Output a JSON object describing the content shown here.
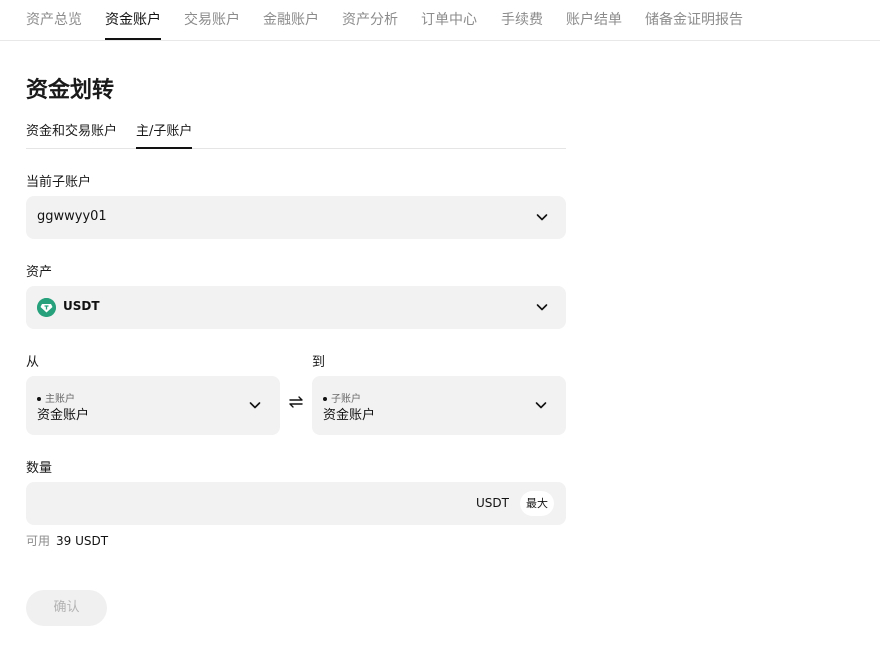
{
  "nav": {
    "items": [
      {
        "label": "资产总览"
      },
      {
        "label": "资金账户"
      },
      {
        "label": "交易账户"
      },
      {
        "label": "金融账户"
      },
      {
        "label": "资产分析"
      },
      {
        "label": "订单中心"
      },
      {
        "label": "手续费"
      },
      {
        "label": "账户结单"
      },
      {
        "label": "储备金证明报告"
      }
    ],
    "active": "资金账户"
  },
  "page": {
    "title": "资金划转"
  },
  "subtabs": [
    {
      "label": "资金和交易账户"
    },
    {
      "label": "主/子账户"
    }
  ],
  "subtab_active": "主/子账户",
  "form": {
    "subaccount": {
      "label": "当前子账户",
      "value": "ggwwyy01"
    },
    "asset": {
      "label": "资产",
      "value": "USDT",
      "icon": "tether-icon",
      "icon_color": "#26a17b"
    },
    "from": {
      "label": "从",
      "account_type": "主账户",
      "account": "资金账户"
    },
    "to": {
      "label": "到",
      "account_type": "子账户",
      "account": "资金账户"
    },
    "amount": {
      "label": "数量",
      "placeholder": "",
      "unit": "USDT",
      "max_label": "最大"
    },
    "available": {
      "label": "可用",
      "value": "39 USDT"
    },
    "confirm_label": "确认"
  }
}
